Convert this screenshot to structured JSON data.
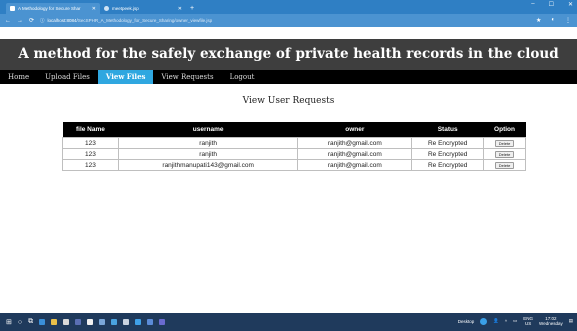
{
  "browser": {
    "tabs": [
      {
        "label": "A Methodology for Secure Shar",
        "active": true
      },
      {
        "label": "meetpeek.jsp",
        "active": false
      }
    ],
    "new_tab": "+",
    "window_controls": {
      "minimize": "–",
      "maximize": "☐",
      "close": "✕"
    },
    "url_host": "localhost:8084/",
    "url_path": "SecSPHR_A_Methodology_for_Secure_Sharing/owner_viewfile.jsp"
  },
  "site": {
    "title": "A method for the safely exchange of private health records in the cloud",
    "menu": [
      {
        "label": "Home",
        "active": false
      },
      {
        "label": "Upload Files",
        "active": false
      },
      {
        "label": "View Files",
        "active": true
      },
      {
        "label": "View Requests",
        "active": false
      },
      {
        "label": "Logout",
        "active": false
      }
    ]
  },
  "requests": {
    "title": "View User Requests",
    "columns": [
      "file Name",
      "username",
      "owner",
      "Status",
      "Option"
    ],
    "rows": [
      {
        "file_name": "123",
        "username": "ranjith",
        "owner": "ranjith@gmail.com",
        "status": "Re Encrypted",
        "option": "Delete"
      },
      {
        "file_name": "123",
        "username": "ranjith",
        "owner": "ranjith@gmail.com",
        "status": "Re Encrypted",
        "option": "Delete"
      },
      {
        "file_name": "123",
        "username": "ranjithmanupati143@gmail.com",
        "owner": "ranjith@gmail.com",
        "status": "Re Encrypted",
        "option": "Delete"
      }
    ]
  },
  "taskbar": {
    "desktop_label": "Desktop",
    "language": "ENG",
    "region": "US",
    "time": "17:02",
    "day": "Wednesday"
  },
  "colors": {
    "tab_bar": "#2f7fc4",
    "header_bg": "#3e3e3e",
    "menu_bg": "#000000",
    "menu_active": "#2fa7e0",
    "taskbar": "#1f3a5c"
  }
}
